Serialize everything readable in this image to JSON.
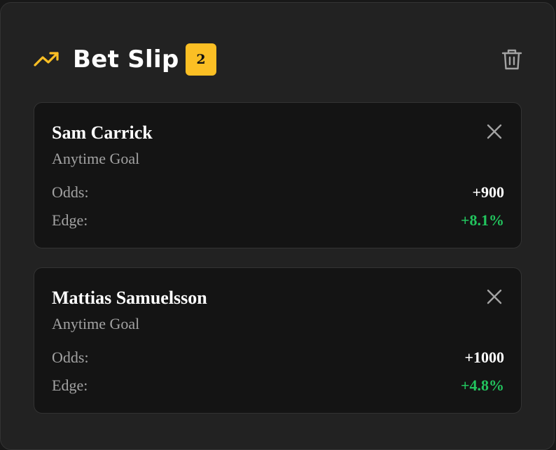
{
  "header": {
    "title": "Bet Slip",
    "count": "2",
    "trend_icon": "trending-up-icon",
    "trash_icon": "trash-icon",
    "accent_color": "#fbbf24"
  },
  "bets": [
    {
      "player": "Sam Carrick",
      "market": "Anytime Goal",
      "odds_label": "Odds:",
      "odds": "+900",
      "edge_label": "Edge:",
      "edge": "+8.1%"
    },
    {
      "player": "Mattias Samuelsson",
      "market": "Anytime Goal",
      "odds_label": "Odds:",
      "odds": "+1000",
      "edge_label": "Edge:",
      "edge": "+4.8%"
    }
  ],
  "colors": {
    "background": "#222222",
    "card": "#141414",
    "positive": "#22c55e",
    "muted_text": "#a3a3a3"
  }
}
